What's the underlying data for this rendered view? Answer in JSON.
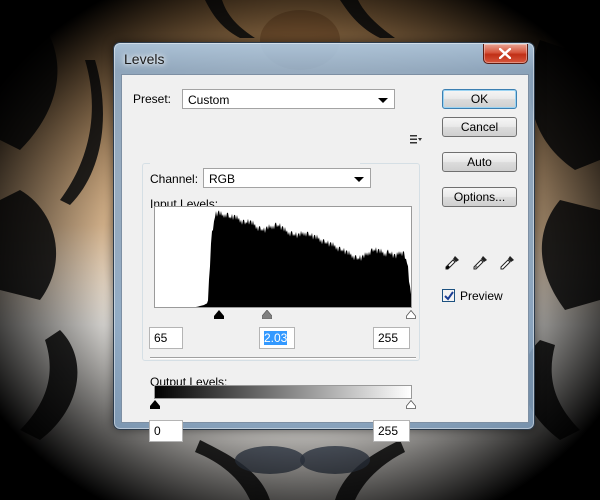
{
  "window": {
    "title": "Levels"
  },
  "preset": {
    "label": "Preset:",
    "value": "Custom"
  },
  "channel": {
    "label": "Channel:",
    "value": "RGB"
  },
  "input_levels": {
    "label": "Input Levels:",
    "shadow": "65",
    "gamma": "2.03",
    "highlight": "255"
  },
  "output_levels": {
    "label": "Output Levels:",
    "low": "0",
    "high": "255"
  },
  "buttons": {
    "ok": "OK",
    "cancel": "Cancel",
    "auto": "Auto",
    "options": "Options..."
  },
  "preview": {
    "label": "Preview",
    "checked": true
  },
  "icons": [
    "close-icon",
    "preset-options-icon",
    "black-eyedropper-icon",
    "gray-eyedropper-icon",
    "white-eyedropper-icon"
  ],
  "colors": {
    "title_close": "#c7452b",
    "selection": "#3399ff"
  },
  "chart_data": {
    "type": "area",
    "x_range": [
      0,
      255
    ],
    "histogram_profile": [
      0,
      0,
      0,
      0,
      0,
      0,
      0,
      0,
      0,
      0,
      0,
      0,
      1,
      2,
      4,
      70,
      92,
      94,
      91,
      93,
      89,
      90,
      88,
      86,
      84,
      85,
      83,
      80,
      78,
      76,
      79,
      80,
      82,
      81,
      78,
      75,
      74,
      72,
      71,
      73,
      74,
      72,
      70,
      69,
      67,
      65,
      63,
      62,
      60,
      58,
      56,
      54,
      52,
      50,
      48,
      49,
      52,
      55,
      57,
      56,
      55,
      53,
      55,
      52,
      50,
      55,
      54,
      44,
      10
    ]
  }
}
